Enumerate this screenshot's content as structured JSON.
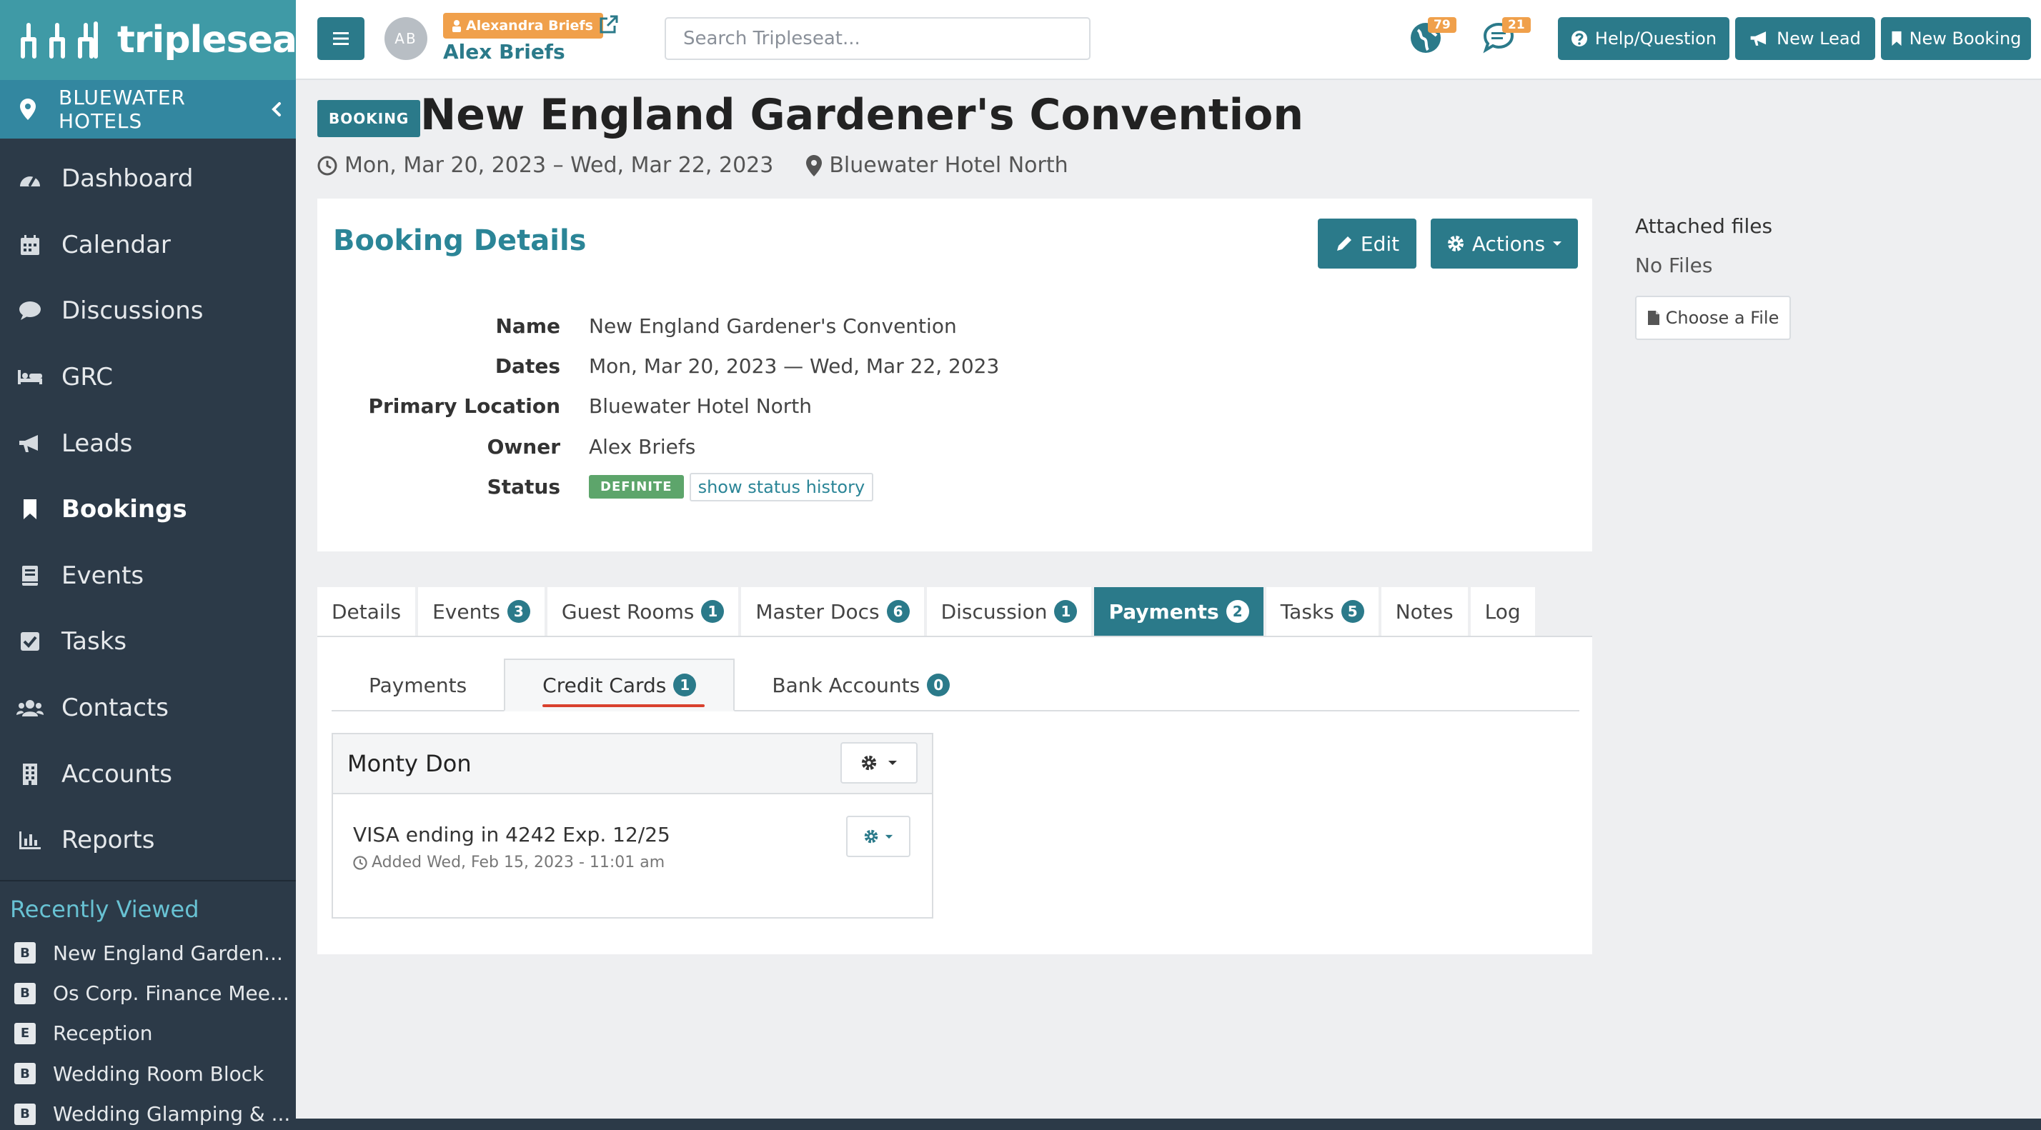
{
  "brand": {
    "name": "tripleseat"
  },
  "sidebar": {
    "org": "BLUEWATER HOTELS",
    "items": [
      {
        "label": "Dashboard",
        "icon": "dashboard-icon"
      },
      {
        "label": "Calendar",
        "icon": "calendar-icon"
      },
      {
        "label": "Discussions",
        "icon": "chat-icon"
      },
      {
        "label": "GRC",
        "icon": "bed-icon"
      },
      {
        "label": "Leads",
        "icon": "megaphone-icon"
      },
      {
        "label": "Bookings",
        "icon": "bookmark-icon"
      },
      {
        "label": "Events",
        "icon": "book-icon"
      },
      {
        "label": "Tasks",
        "icon": "checkbox-icon"
      },
      {
        "label": "Contacts",
        "icon": "users-icon"
      },
      {
        "label": "Accounts",
        "icon": "building-icon"
      },
      {
        "label": "Reports",
        "icon": "bar-chart-icon"
      }
    ],
    "recent_title": "Recently Viewed",
    "recent": [
      {
        "badge": "B",
        "label": "New England Garden..."
      },
      {
        "badge": "B",
        "label": "Os Corp. Finance Mee..."
      },
      {
        "badge": "E",
        "label": "Reception"
      },
      {
        "badge": "B",
        "label": "Wedding Room Block"
      },
      {
        "badge": "B",
        "label": "Wedding Glamping & ..."
      }
    ]
  },
  "topbar": {
    "avatar_initials": "AB",
    "user_tag": "Alexandra Briefs",
    "user_name": "Alex Briefs",
    "search_placeholder": "Search Tripleseat...",
    "globe_count": "79",
    "chat_count": "21",
    "help_label": "Help/Question",
    "new_lead_label": "New Lead",
    "new_booking_label": "New Booking"
  },
  "header": {
    "badge": "BOOKING",
    "title": "New England Gardener's Convention",
    "dates": "Mon, Mar 20, 2023 – Wed, Mar 22, 2023",
    "location": "Bluewater Hotel North"
  },
  "details": {
    "title": "Booking Details",
    "edit_label": "Edit",
    "actions_label": "Actions",
    "rows": [
      {
        "label": "Name",
        "value": "New England Gardener's Convention"
      },
      {
        "label": "Dates",
        "value": "Mon, Mar 20, 2023 — Wed, Mar 22, 2023"
      },
      {
        "label": "Primary Location",
        "value": "Bluewater Hotel North"
      },
      {
        "label": "Owner",
        "value": "Alex Briefs"
      }
    ],
    "status_label": "Status",
    "status_value": "DEFINITE",
    "status_link": "show status history"
  },
  "files": {
    "title": "Attached files",
    "empty": "No Files",
    "choose_label": "Choose a File"
  },
  "tabs": [
    {
      "label": "Details",
      "count": ""
    },
    {
      "label": "Events",
      "count": "3"
    },
    {
      "label": "Guest Rooms",
      "count": "1"
    },
    {
      "label": "Master Docs",
      "count": "6"
    },
    {
      "label": "Discussion",
      "count": "1"
    },
    {
      "label": "Payments",
      "count": "2"
    },
    {
      "label": "Tasks",
      "count": "5"
    },
    {
      "label": "Notes",
      "count": ""
    },
    {
      "label": "Log",
      "count": ""
    }
  ],
  "subtabs": [
    {
      "label": "Payments",
      "count": ""
    },
    {
      "label": "Credit Cards",
      "count": "1"
    },
    {
      "label": "Bank Accounts",
      "count": "0"
    }
  ],
  "card": {
    "holder": "Monty Don",
    "description": "VISA ending in 4242 Exp. 12/25",
    "added": "Added Wed, Feb 15, 2023 - 11:01 am"
  },
  "colors": {
    "brand": "#3f9aa6",
    "primary": "#2b7a8a",
    "sidebar": "#2c3a48",
    "badge_orange": "#f0a04b",
    "status_green": "#5da56b",
    "active_underline": "#d9412e"
  }
}
